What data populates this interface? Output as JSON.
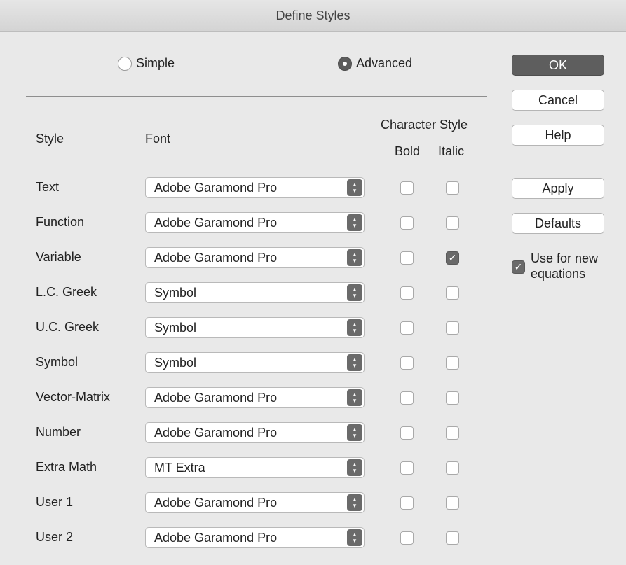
{
  "window": {
    "title": "Define Styles"
  },
  "mode": {
    "simple": {
      "label": "Simple",
      "selected": false
    },
    "advanced": {
      "label": "Advanced",
      "selected": true
    }
  },
  "headers": {
    "style": "Style",
    "font": "Font",
    "character_style": "Character Style",
    "bold": "Bold",
    "italic": "Italic"
  },
  "rows": [
    {
      "style": "Text",
      "font": "Adobe Garamond Pro",
      "bold": false,
      "italic": false
    },
    {
      "style": "Function",
      "font": "Adobe Garamond Pro",
      "bold": false,
      "italic": false
    },
    {
      "style": "Variable",
      "font": "Adobe Garamond Pro",
      "bold": false,
      "italic": true
    },
    {
      "style": "L.C. Greek",
      "font": "Symbol",
      "bold": false,
      "italic": false
    },
    {
      "style": "U.C. Greek",
      "font": "Symbol",
      "bold": false,
      "italic": false
    },
    {
      "style": "Symbol",
      "font": "Symbol",
      "bold": false,
      "italic": false
    },
    {
      "style": "Vector-Matrix",
      "font": "Adobe Garamond Pro",
      "bold": false,
      "italic": false
    },
    {
      "style": "Number",
      "font": "Adobe Garamond Pro",
      "bold": false,
      "italic": false
    },
    {
      "style": "Extra Math",
      "font": "MT Extra",
      "bold": false,
      "italic": false
    },
    {
      "style": "User 1",
      "font": "Adobe Garamond Pro",
      "bold": false,
      "italic": false
    },
    {
      "style": "User 2",
      "font": "Adobe Garamond Pro",
      "bold": false,
      "italic": false
    }
  ],
  "buttons": {
    "ok": "OK",
    "cancel": "Cancel",
    "help": "Help",
    "apply": "Apply",
    "defaults": "Defaults"
  },
  "use_for_new": {
    "line1": "Use for new",
    "line2": "equations",
    "checked": true
  },
  "colors": {
    "window_bg": "#e9e9e9",
    "primary_button": "#5e5e5e",
    "checked_fill": "#6a6a6a"
  }
}
